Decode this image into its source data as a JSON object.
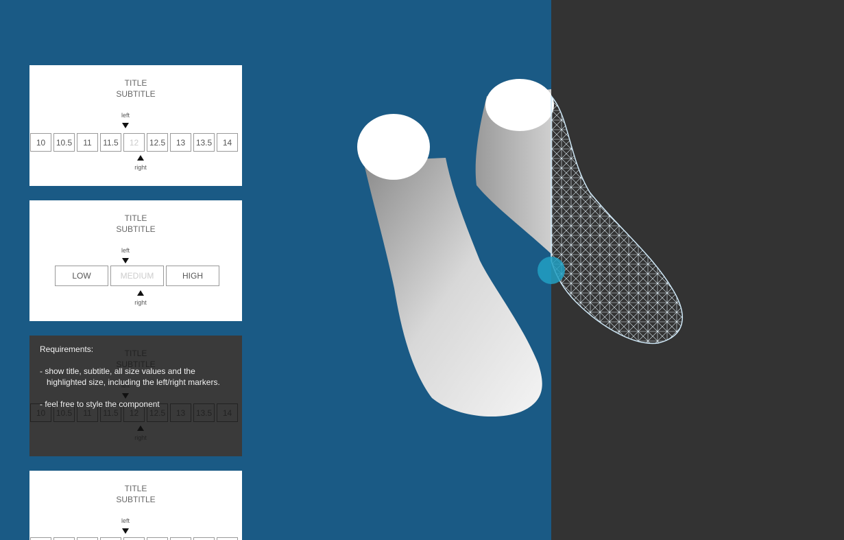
{
  "cards": [
    {
      "title": "TITLE",
      "subtitle": "SUBTITLE",
      "left_label": "left",
      "right_label": "right",
      "sizes": [
        "10",
        "10.5",
        "11",
        "11.5",
        "12",
        "12.5",
        "13",
        "13.5",
        "14"
      ],
      "highlighted": "12"
    },
    {
      "title": "TITLE",
      "subtitle": "SUBTITLE",
      "left_label": "left",
      "right_label": "right",
      "levels": [
        "LOW",
        "MEDIUM",
        "HIGH"
      ],
      "highlighted": "MEDIUM"
    },
    {
      "title": "TITLE",
      "subtitle": "SUBTITLE",
      "left_label": "left",
      "right_label": "right",
      "sizes": [
        "10",
        "10.5",
        "11",
        "11.5",
        "12",
        "12.5",
        "13",
        "13.5",
        "14"
      ],
      "highlighted": "12",
      "overlay": {
        "heading": "Requirements:",
        "line1": "- show title, subtitle, all size values and the",
        "line2": "   highlighted size, including the left/right markers.",
        "line3": "- feel free to style the component"
      }
    },
    {
      "title": "TITLE",
      "subtitle": "SUBTITLE",
      "left_label": "left"
    }
  ],
  "colors": {
    "background_left": "#1a5a85",
    "background_right": "#333333",
    "handle": "#22a0c3",
    "wireframe": "#cfe8f7"
  },
  "icons": {
    "left_marker": "triangle-down-icon",
    "right_marker": "triangle-up-icon"
  }
}
